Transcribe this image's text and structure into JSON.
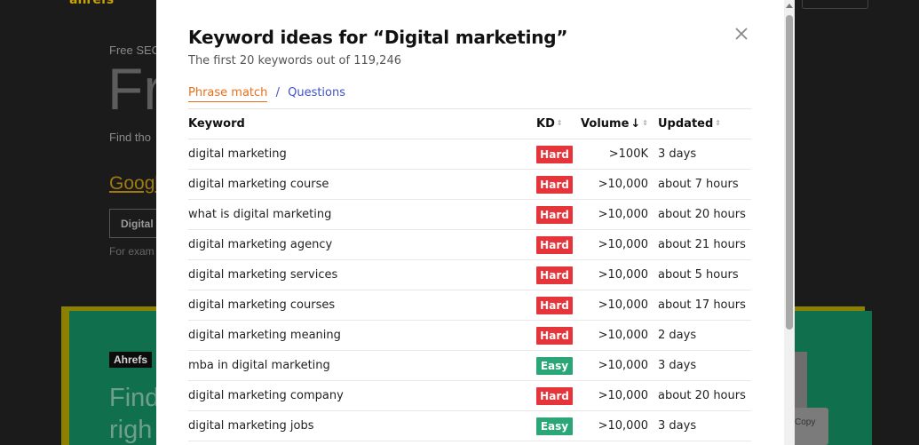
{
  "background": {
    "logo": "ahrefs",
    "small_heading": "Free SEO",
    "hero": "Fr",
    "find_text": "Find tho",
    "google_link": "Googl",
    "input_value": "Digital",
    "example_text": "For exam",
    "badge": "Ahrefs",
    "green_title_line1": "Find",
    "green_title_line2": "righ",
    "copy_text": "Copy"
  },
  "modal": {
    "title": "Keyword ideas for “Digital marketing”",
    "subtitle": "The first 20 keywords out of 119,246",
    "tabs": {
      "phrase_match": "Phrase match",
      "separator": "/",
      "questions": "Questions"
    },
    "table": {
      "headers": {
        "keyword": "Keyword",
        "kd": "KD",
        "volume": "Volume",
        "volume_arrow": "↓",
        "updated": "Updated"
      },
      "rows": [
        {
          "keyword": "digital marketing",
          "kd": "Hard",
          "volume": ">100K",
          "updated": "3 days"
        },
        {
          "keyword": "digital marketing course",
          "kd": "Hard",
          "volume": ">10,000",
          "updated": "about 7 hours"
        },
        {
          "keyword": "what is digital marketing",
          "kd": "Hard",
          "volume": ">10,000",
          "updated": "about 20 hours"
        },
        {
          "keyword": "digital marketing agency",
          "kd": "Hard",
          "volume": ">10,000",
          "updated": "about 21 hours"
        },
        {
          "keyword": "digital marketing services",
          "kd": "Hard",
          "volume": ">10,000",
          "updated": "about 5 hours"
        },
        {
          "keyword": "digital marketing courses",
          "kd": "Hard",
          "volume": ">10,000",
          "updated": "about 17 hours"
        },
        {
          "keyword": "digital marketing meaning",
          "kd": "Hard",
          "volume": ">10,000",
          "updated": "2 days"
        },
        {
          "keyword": "mba in digital marketing",
          "kd": "Easy",
          "volume": ">10,000",
          "updated": "3 days"
        },
        {
          "keyword": "digital marketing company",
          "kd": "Hard",
          "volume": ">10,000",
          "updated": "about 20 hours"
        },
        {
          "keyword": "digital marketing jobs",
          "kd": "Easy",
          "volume": ">10,000",
          "updated": "3 days"
        }
      ]
    }
  },
  "colors": {
    "hard": "#e5343a",
    "easy": "#2aa677",
    "accent_orange": "#e8711c",
    "link_blue": "#3f52cc"
  }
}
